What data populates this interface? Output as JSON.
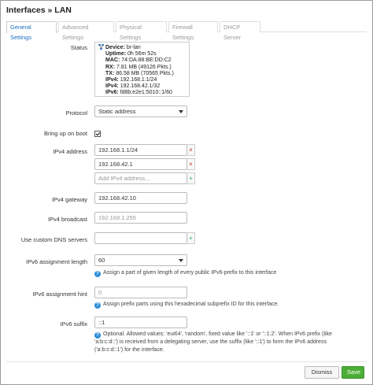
{
  "window": {
    "title": "Interfaces » LAN"
  },
  "tabs": [
    {
      "label": "General Settings"
    },
    {
      "label": "Advanced Settings"
    },
    {
      "label": "Physical Settings"
    },
    {
      "label": "Firewall Settings"
    },
    {
      "label": "DHCP Server"
    }
  ],
  "status": {
    "label": "Status",
    "device_key": "Device:",
    "device_val": "br-lan",
    "uptime_key": "Uptime:",
    "uptime_val": "0h 56m 52s",
    "mac_key": "MAC:",
    "mac_val": "74:DA:88:BE:DD:C2",
    "rx_key": "RX:",
    "rx_val": "7.81 MB (49126 Pkts.)",
    "tx_key": "TX:",
    "tx_val": "86.58 MB (70565 Pkts.)",
    "ipv4a_key": "IPv4:",
    "ipv4a_val": "192.168.1.1/24",
    "ipv4b_key": "IPv4:",
    "ipv4b_val": "192.168.42.1/32",
    "ipv6_key": "IPv6:",
    "ipv6_val": "fd8b:e2e1:5010::1/60"
  },
  "protocol": {
    "label": "Protocol",
    "value": "Static address"
  },
  "bring_up": {
    "label": "Bring up on boot",
    "checked": true
  },
  "ipv4_address": {
    "label": "IPv4 address",
    "values": [
      "192.168.1.1/24",
      "192.168.42.1"
    ],
    "placeholder": "Add IPv4 address..."
  },
  "ipv4_gateway": {
    "label": "IPv4 gateway",
    "value": "192.168.42.10"
  },
  "ipv4_broadcast": {
    "label": "IPv4 broadcast",
    "placeholder": "192.168.1.255"
  },
  "dns": {
    "label": "Use custom DNS servers",
    "value": ""
  },
  "ipv6_len": {
    "label": "IPv6 assignment length",
    "value": "60",
    "help": "Assign a part of given length of every public IPv6-prefix to this interface"
  },
  "ipv6_hint": {
    "label": "IPv6 assignment hint",
    "placeholder": "0",
    "help": "Assign prefix parts using this hexadecimal subprefix ID for this interface."
  },
  "ipv6_suffix": {
    "label": "IPv6 suffix",
    "value": "::1",
    "help_l1": "Optional. Allowed values: 'eui64', 'random', fixed value like '::1' or '::1:2'. When IPv6 prefix (like",
    "help_l2": "'a:b:c:d::') is received from a delegating server, use the suffix (like '::1') to form the IPv6 address",
    "help_l3": "('a:b:c:d::1') for the interface."
  },
  "buttons": {
    "dismiss": "Dismiss",
    "save": "Save"
  },
  "icons": {
    "remove": "×",
    "add": "+",
    "help": "?"
  },
  "colors": {
    "link": "#1a6fc1",
    "save": "#4cae37",
    "remove": "#c0392b",
    "add": "#27ae60"
  }
}
